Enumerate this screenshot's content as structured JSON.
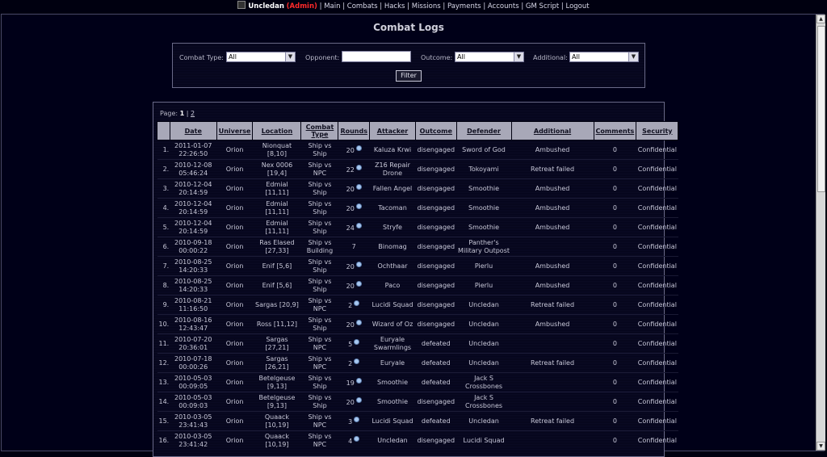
{
  "nav": {
    "username": "Uncledan",
    "role": "(Admin)",
    "links": [
      "Main",
      "Combats",
      "Hacks",
      "Missions",
      "Payments",
      "Accounts",
      "GM Script",
      "Logout"
    ]
  },
  "page": {
    "title": "Combat Logs"
  },
  "filter": {
    "combat_type_label": "Combat Type:",
    "combat_type_value": "All",
    "opponent_label": "Opponent:",
    "opponent_value": "",
    "outcome_label": "Outcome:",
    "outcome_value": "All",
    "additional_label": "Additional:",
    "additional_value": "All",
    "button": "Filter"
  },
  "pager": {
    "label": "Page:",
    "current": "1",
    "sep": "|",
    "other": "2"
  },
  "table": {
    "headers": [
      "Date",
      "Universe",
      "Location",
      "Combat Type",
      "Rounds",
      "Attacker",
      "Outcome",
      "Defender",
      "Additional",
      "Comments",
      "Security"
    ],
    "rows": [
      {
        "n": "1.",
        "date": "2011-01-07 22:26:50",
        "universe": "Orion",
        "location": "Nionquat [8,10]",
        "type": "Ship vs Ship",
        "rounds": "20",
        "dot": true,
        "attacker": "Kaluza Krwi",
        "outcome": "disengaged",
        "defender": "Sword of God",
        "additional": "Ambushed",
        "comments": "0",
        "security": "Confidential"
      },
      {
        "n": "2.",
        "date": "2010-12-08 05:46:24",
        "universe": "Orion",
        "location": "Nex 0006 [19,4]",
        "type": "Ship vs NPC",
        "rounds": "22",
        "dot": true,
        "attacker": "Z16 Repair Drone",
        "outcome": "disengaged",
        "defender": "Tokoyami",
        "additional": "Retreat failed",
        "comments": "0",
        "security": "Confidential"
      },
      {
        "n": "3.",
        "date": "2010-12-04 20:14:59",
        "universe": "Orion",
        "location": "Edmial [11,11]",
        "type": "Ship vs Ship",
        "rounds": "20",
        "dot": true,
        "attacker": "Fallen Angel",
        "outcome": "disengaged",
        "defender": "Smoothie",
        "additional": "Ambushed",
        "comments": "0",
        "security": "Confidential"
      },
      {
        "n": "4.",
        "date": "2010-12-04 20:14:59",
        "universe": "Orion",
        "location": "Edmial [11,11]",
        "type": "Ship vs Ship",
        "rounds": "20",
        "dot": true,
        "attacker": "Tacoman",
        "outcome": "disengaged",
        "defender": "Smoothie",
        "additional": "Ambushed",
        "comments": "0",
        "security": "Confidential"
      },
      {
        "n": "5.",
        "date": "2010-12-04 20:14:59",
        "universe": "Orion",
        "location": "Edmial [11,11]",
        "type": "Ship vs Ship",
        "rounds": "24",
        "dot": true,
        "attacker": "Stryfe",
        "outcome": "disengaged",
        "defender": "Smoothie",
        "additional": "Ambushed",
        "comments": "0",
        "security": "Confidential"
      },
      {
        "n": "6.",
        "date": "2010-09-18 00:00:22",
        "universe": "Orion",
        "location": "Ras Elased [27,33]",
        "type": "Ship vs Building",
        "rounds": "7",
        "dot": false,
        "attacker": "Binomag",
        "outcome": "disengaged",
        "defender": "Panther's Military Outpost",
        "additional": "",
        "comments": "0",
        "security": "Confidential"
      },
      {
        "n": "7.",
        "date": "2010-08-25 14:20:33",
        "universe": "Orion",
        "location": "Enif [5,6]",
        "type": "Ship vs Ship",
        "rounds": "20",
        "dot": true,
        "attacker": "Ochthaar",
        "outcome": "disengaged",
        "defender": "Pierlu",
        "additional": "Ambushed",
        "comments": "0",
        "security": "Confidential"
      },
      {
        "n": "8.",
        "date": "2010-08-25 14:20:33",
        "universe": "Orion",
        "location": "Enif [5,6]",
        "type": "Ship vs Ship",
        "rounds": "20",
        "dot": true,
        "attacker": "Paco",
        "outcome": "disengaged",
        "defender": "Pierlu",
        "additional": "Ambushed",
        "comments": "0",
        "security": "Confidential"
      },
      {
        "n": "9.",
        "date": "2010-08-21 11:16:50",
        "universe": "Orion",
        "location": "Sargas [20,9]",
        "type": "Ship vs NPC",
        "rounds": "2",
        "dot": true,
        "attacker": "Lucidi Squad",
        "outcome": "disengaged",
        "defender": "Uncledan",
        "additional": "Retreat failed",
        "comments": "0",
        "security": "Confidential"
      },
      {
        "n": "10.",
        "date": "2010-08-16 12:43:47",
        "universe": "Orion",
        "location": "Ross [11,12]",
        "type": "Ship vs Ship",
        "rounds": "20",
        "dot": true,
        "attacker": "Wizard of Oz",
        "outcome": "disengaged",
        "defender": "Uncledan",
        "additional": "Ambushed",
        "comments": "0",
        "security": "Confidential"
      },
      {
        "n": "11.",
        "date": "2010-07-20 20:36:01",
        "universe": "Orion",
        "location": "Sargas [27,21]",
        "type": "Ship vs NPC",
        "rounds": "5",
        "dot": true,
        "attacker": "Euryale Swarmlings",
        "outcome": "defeated",
        "defender": "Uncledan",
        "additional": "",
        "comments": "0",
        "security": "Confidential"
      },
      {
        "n": "12.",
        "date": "2010-07-18 00:00:26",
        "universe": "Orion",
        "location": "Sargas [26,21]",
        "type": "Ship vs NPC",
        "rounds": "2",
        "dot": true,
        "attacker": "Euryale",
        "outcome": "defeated",
        "defender": "Uncledan",
        "additional": "Retreat failed",
        "comments": "0",
        "security": "Confidential"
      },
      {
        "n": "13.",
        "date": "2010-05-03 00:09:05",
        "universe": "Orion",
        "location": "Betelgeuse [9,13]",
        "type": "Ship vs Ship",
        "rounds": "19",
        "dot": true,
        "attacker": "Smoothie",
        "outcome": "defeated",
        "defender": "Jack S Crossbones",
        "additional": "",
        "comments": "0",
        "security": "Confidential"
      },
      {
        "n": "14.",
        "date": "2010-05-03 00:09:03",
        "universe": "Orion",
        "location": "Betelgeuse [9,13]",
        "type": "Ship vs Ship",
        "rounds": "20",
        "dot": true,
        "attacker": "Smoothie",
        "outcome": "disengaged",
        "defender": "Jack S Crossbones",
        "additional": "",
        "comments": "0",
        "security": "Confidential"
      },
      {
        "n": "15.",
        "date": "2010-03-05 23:41:43",
        "universe": "Orion",
        "location": "Quaack [10,19]",
        "type": "Ship vs NPC",
        "rounds": "3",
        "dot": true,
        "attacker": "Lucidi Squad",
        "outcome": "defeated",
        "defender": "Uncledan",
        "additional": "Retreat failed",
        "comments": "0",
        "security": "Confidential"
      },
      {
        "n": "16.",
        "date": "2010-03-05 23:41:42",
        "universe": "Orion",
        "location": "Quaack [10,19]",
        "type": "Ship vs NPC",
        "rounds": "4",
        "dot": true,
        "attacker": "Uncledan",
        "outcome": "disengaged",
        "defender": "Lucidi Squad",
        "additional": "",
        "comments": "0",
        "security": "Confidential"
      }
    ]
  }
}
